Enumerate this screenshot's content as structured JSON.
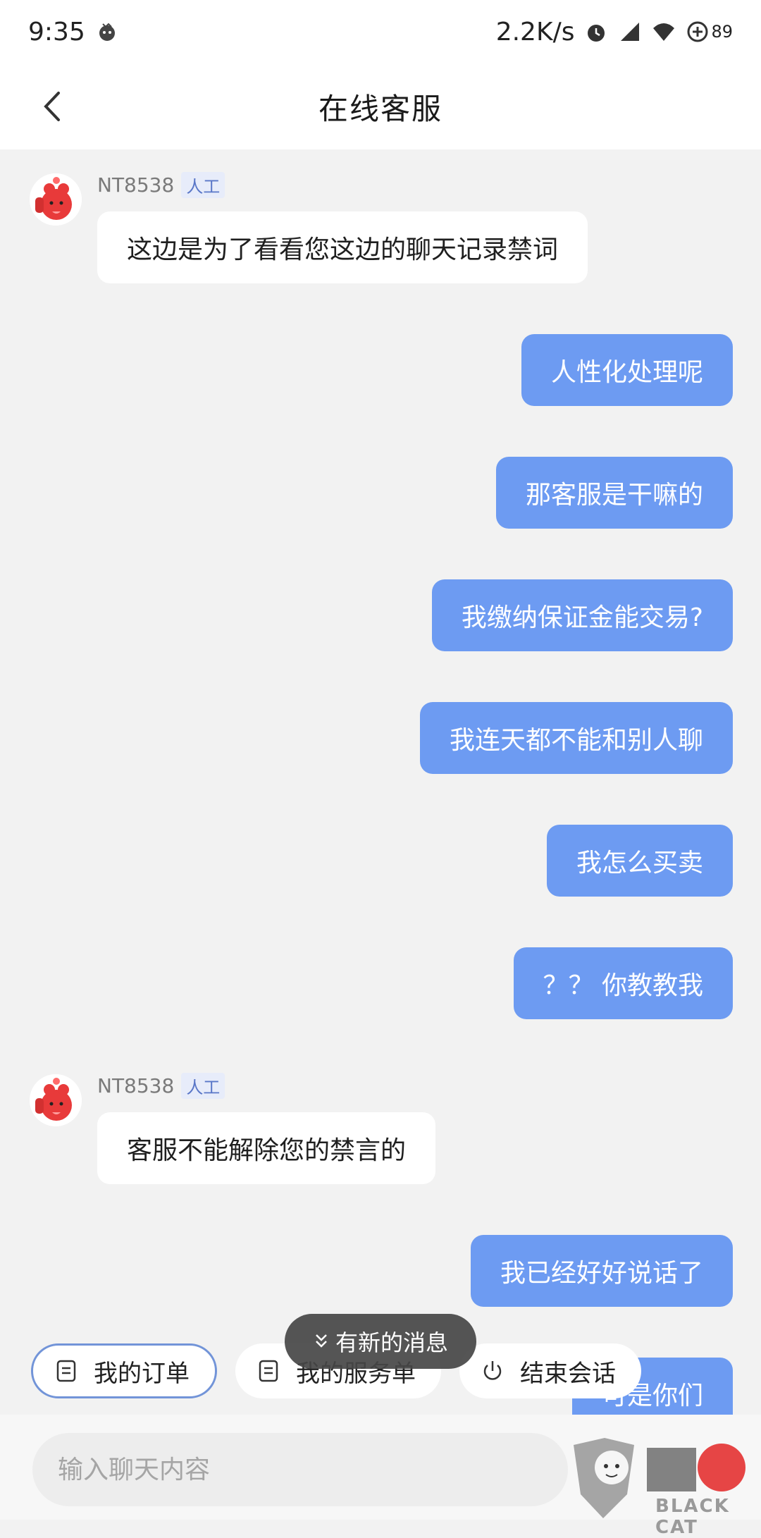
{
  "status_bar": {
    "time": "9:35",
    "net_speed": "2.2K/s",
    "battery": "89"
  },
  "header": {
    "title": "在线客服"
  },
  "messages": [
    {
      "sender": "NT8538",
      "tag": "人工",
      "text": "这边是为了看看您这边的聊天记录禁词"
    },
    {
      "text": "人性化处理呢"
    },
    {
      "text": "那客服是干嘛的"
    },
    {
      "text": "我缴纳保证金能交易?"
    },
    {
      "text": "我连天都不能和别人聊"
    },
    {
      "text": "我怎么买卖"
    },
    {
      "text": "？？ 你教教我"
    },
    {
      "sender": "NT8538",
      "tag": "人工",
      "text": "客服不能解除您的禁言的"
    },
    {
      "text": "我已经好好说话了"
    },
    {
      "text": "可是你们"
    }
  ],
  "quick_actions": {
    "my_orders": "我的订单",
    "my_service_orders": "我的服务单",
    "end_session": "结束会话"
  },
  "new_message_toast": "有新的消息",
  "input": {
    "placeholder": "输入聊天内容"
  },
  "watermark": {
    "brand": "BLACK CAT",
    "logo_text": "黑猫"
  },
  "colors": {
    "outgoing_bubble": "#6d9bf2",
    "incoming_bubble": "#ffffff",
    "background": "#f2f2f2"
  }
}
